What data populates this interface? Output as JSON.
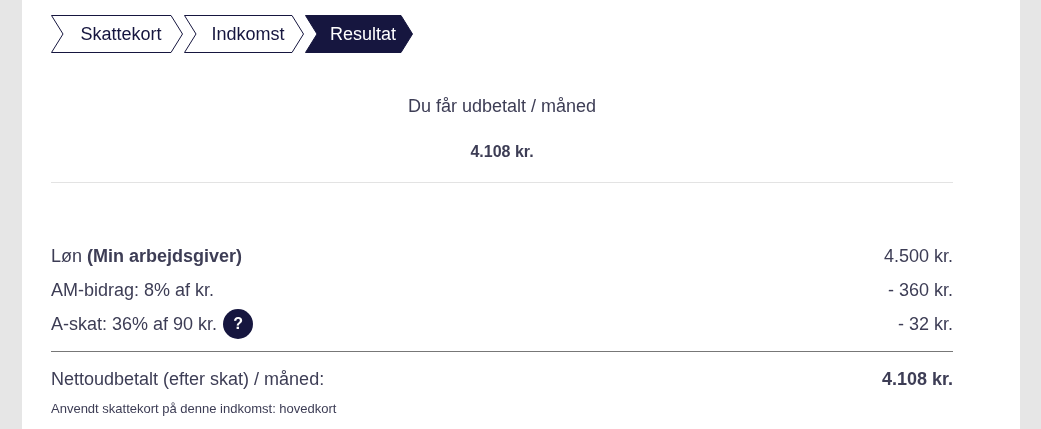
{
  "steps": [
    {
      "label": "Skattekort",
      "selected": false
    },
    {
      "label": "Indkomst",
      "selected": false
    },
    {
      "label": "Resultat",
      "selected": true
    }
  ],
  "summary": {
    "label": "Du får udbetalt / måned",
    "amount": "4.108 kr."
  },
  "lines": [
    {
      "label": "Løn **(Min arbejdsgiver)**",
      "amount": "4.500 kr."
    },
    {
      "label": "AM-bidrag: 8% af kr.",
      "amount": "- 360 kr."
    },
    {
      "label": "A-skat: 36% af 90 kr.",
      "amount": "- 32 kr.",
      "help": "?"
    }
  ],
  "net": {
    "label": "Nettoudbetalt (efter skat) / måned:",
    "amount": "4.108 kr.",
    "note": "Anvendt skattekort på denne indkomst: hovedkort"
  }
}
